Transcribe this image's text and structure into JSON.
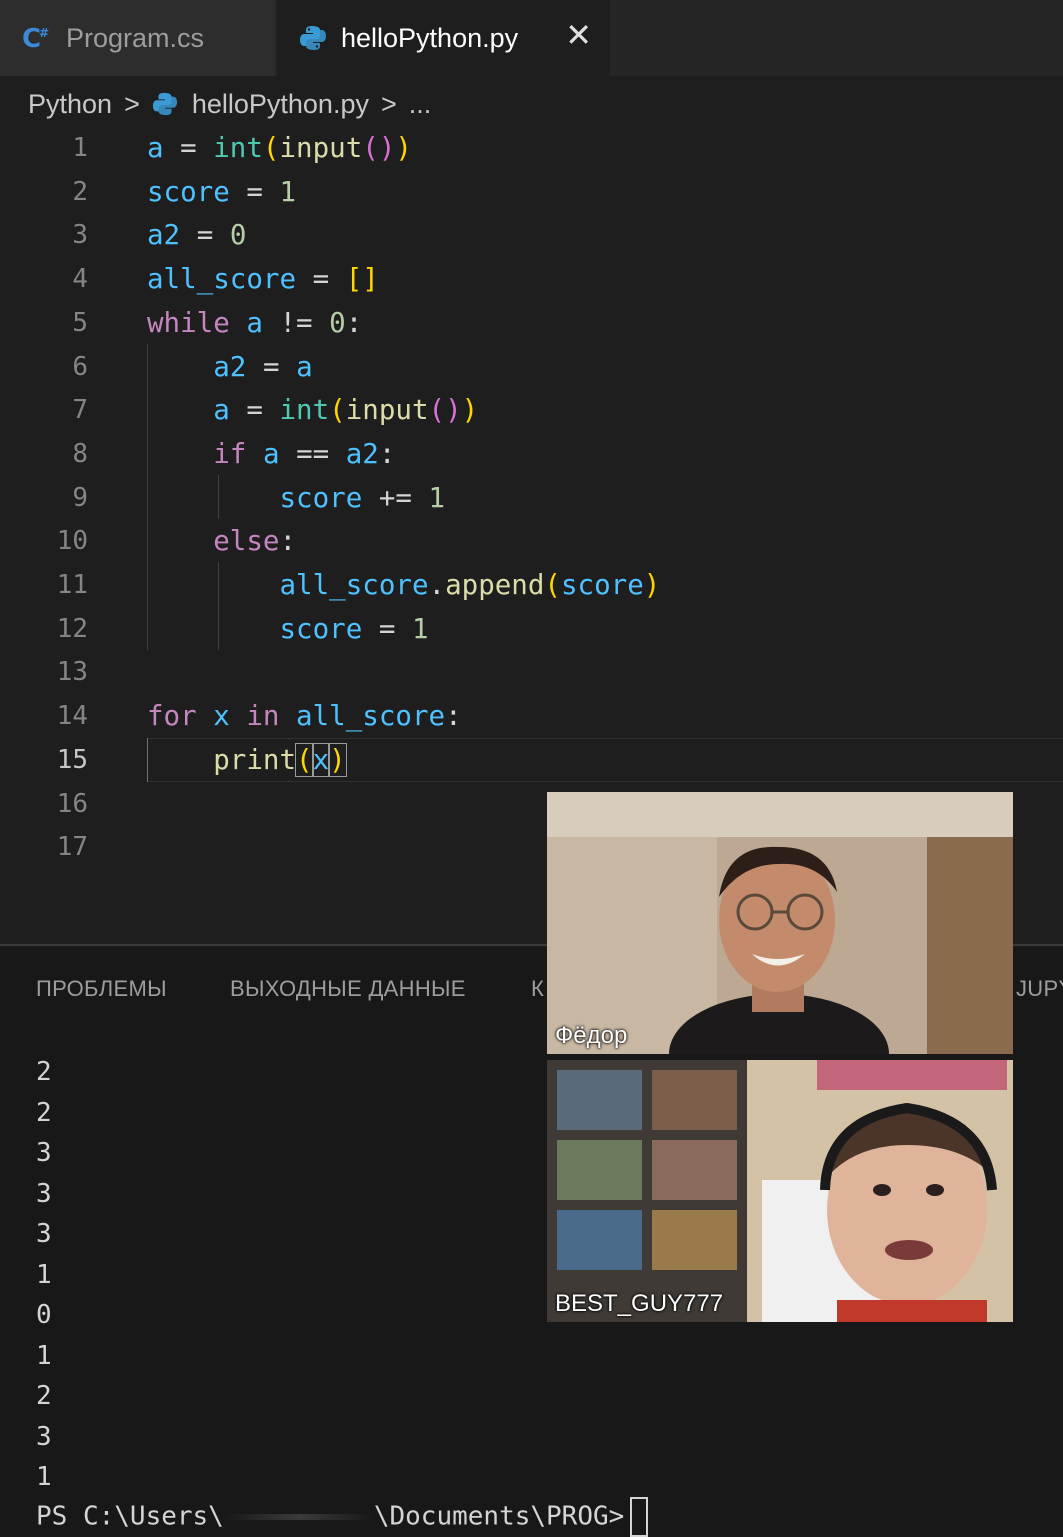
{
  "tabs": [
    {
      "label": "Program.cs",
      "icon": "csharp-icon",
      "active": false
    },
    {
      "label": "helloPython.py",
      "icon": "python-icon",
      "active": true,
      "close": "✕"
    }
  ],
  "breadcrumb": {
    "folder": "Python",
    "file": "helloPython.py",
    "more": "...",
    "separator": ">"
  },
  "editor": {
    "language": "python",
    "current_line": 15,
    "line_numbers": [
      "1",
      "2",
      "3",
      "4",
      "5",
      "6",
      "7",
      "8",
      "9",
      "10",
      "11",
      "12",
      "13",
      "14",
      "15",
      "16",
      "17"
    ],
    "lines": [
      "a = int(input())",
      "score = 1",
      "a2 = 0",
      "all_score = []",
      "while a != 0:",
      "    a2 = a",
      "    a = int(input())",
      "    if a == a2:",
      "        score += 1",
      "    else:",
      "        all_score.append(score)",
      "        score = 1",
      "",
      "for x in all_score:",
      "    print(x)",
      "",
      ""
    ]
  },
  "panel": {
    "tabs": [
      "ПРОБЛЕМЫ",
      "ВЫХОДНЫЕ ДАННЫЕ",
      "К",
      "JUPY"
    ],
    "output": [
      "2",
      "2",
      "3",
      "3",
      "3",
      "1",
      "0",
      "1",
      "2",
      "3",
      "1"
    ],
    "prompt_start": "PS C:\\Users\\",
    "prompt_end": "\\Documents\\PROG>"
  },
  "video_call": {
    "participants": [
      {
        "name": "Фёдор"
      },
      {
        "name": "BEST_GUY777"
      }
    ]
  },
  "colors": {
    "variable": "#4fc1ff",
    "function": "#dcdcaa",
    "builtin": "#4ec9b0",
    "number": "#b5cea8",
    "keyword": "#c586c0",
    "bracket1": "#ffd700",
    "bracket2": "#da70d6"
  }
}
